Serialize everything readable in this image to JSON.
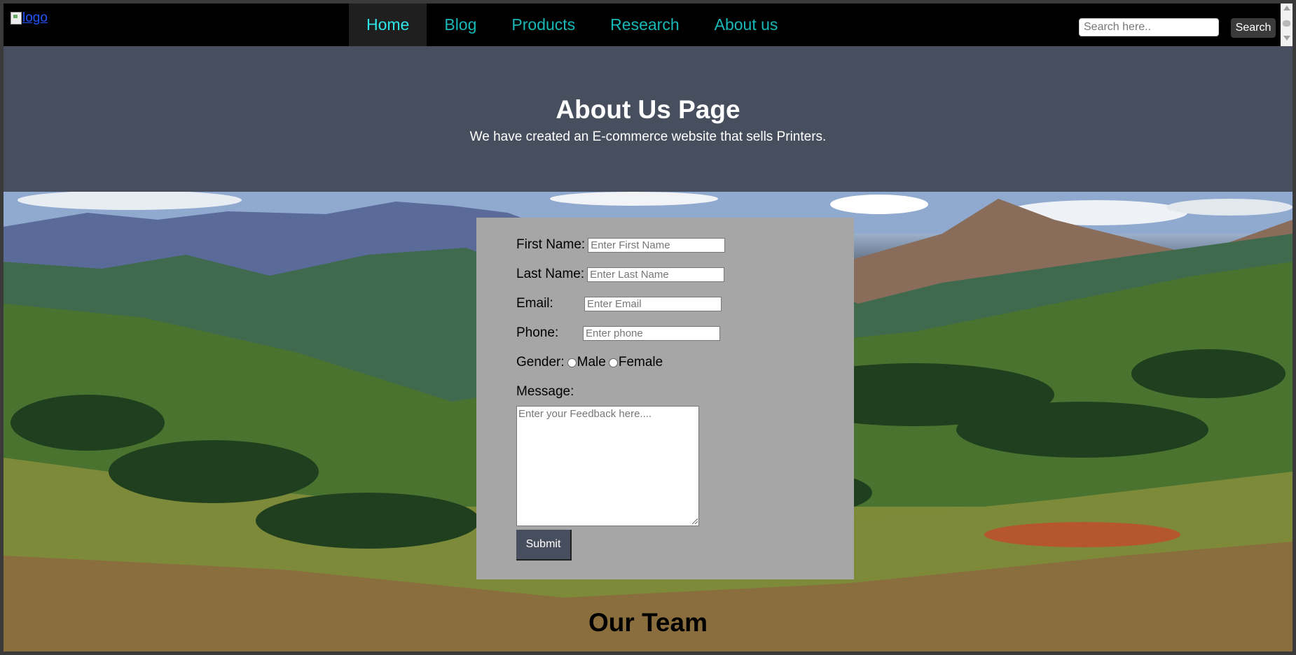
{
  "navbar": {
    "logo_alt": "logo",
    "items": [
      {
        "label": "Home",
        "active": true
      },
      {
        "label": "Blog",
        "active": false
      },
      {
        "label": "Products",
        "active": false
      },
      {
        "label": "Research",
        "active": false
      },
      {
        "label": "About us",
        "active": false
      }
    ],
    "search": {
      "placeholder": "Search here..",
      "value": "",
      "button_label": "Search"
    }
  },
  "header": {
    "title": "About Us Page",
    "subtitle": "We have created an E-commerce website that sells Printers."
  },
  "form": {
    "first_name": {
      "label": "First Name:",
      "placeholder": "Enter First Name",
      "value": ""
    },
    "last_name": {
      "label": "Last Name:",
      "placeholder": "Enter Last Name",
      "value": ""
    },
    "email": {
      "label": "Email:",
      "placeholder": "Enter Email",
      "value": ""
    },
    "phone": {
      "label": "Phone:",
      "placeholder": "Enter phone",
      "value": ""
    },
    "gender": {
      "label": "Gender:",
      "options": [
        "Male",
        "Female"
      ],
      "selected": null
    },
    "message": {
      "label": "Message:",
      "placeholder": "Enter your Feedback here....",
      "value": ""
    },
    "submit_label": "Submit"
  },
  "team": {
    "title": "Our Team"
  },
  "colors": {
    "navbar_bg": "#000000",
    "nav_text": "#19b8b8",
    "nav_active_text": "#2ee6e6",
    "header_bg": "#474e5d",
    "form_bg": "#a6a6a6",
    "submit_bg": "#474e5d"
  }
}
